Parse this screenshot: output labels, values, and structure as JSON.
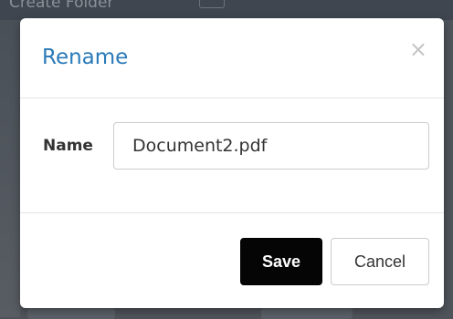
{
  "background": {
    "partial_link": "Create Folder"
  },
  "dialog": {
    "title": "Rename",
    "close_icon": "close-icon",
    "close_glyph": "×",
    "name_label": "Name",
    "name_value": "Document2.pdf",
    "save_label": "Save",
    "cancel_label": "Cancel"
  },
  "colors": {
    "title": "#2a7ab9",
    "save_bg": "#050505",
    "overlay": "#4f545b"
  }
}
